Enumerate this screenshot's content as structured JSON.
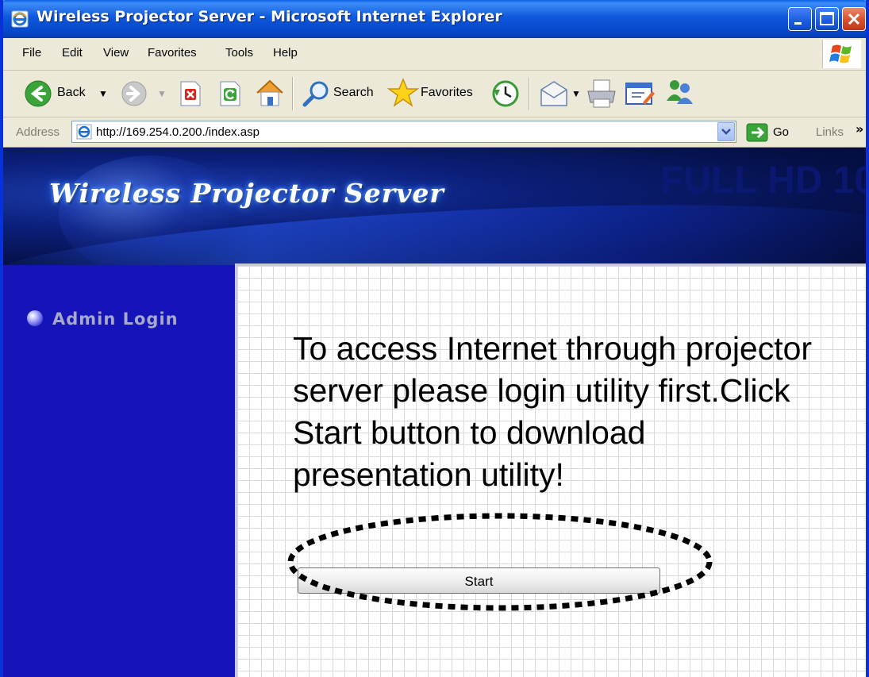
{
  "window": {
    "title": "Wireless Projector Server - Microsoft Internet Explorer"
  },
  "menubar": {
    "items": [
      "File",
      "Edit",
      "View",
      "Favorites",
      "Tools",
      "Help"
    ]
  },
  "toolbar": {
    "back_label": "Back",
    "search_label": "Search",
    "favorites_label": "Favorites"
  },
  "addressbar": {
    "label": "Address",
    "url": "http://169.254.0.200./index.asp",
    "go_label": "Go",
    "links_label": "Links",
    "links_chevron": "»"
  },
  "page": {
    "banner_title": "Wireless Projector Server",
    "banner_badge": "FULL HD 10",
    "sidebar": {
      "items": [
        {
          "label": "Admin Login"
        }
      ]
    },
    "message": "To access Internet through projector server please login utility first.Click Start button to download presentation utility!",
    "start_button": "Start"
  },
  "colors": {
    "titlebar": "#0546c7",
    "sidebar": "#1414b8",
    "banner": "#050f45",
    "highlight": "#000000"
  }
}
